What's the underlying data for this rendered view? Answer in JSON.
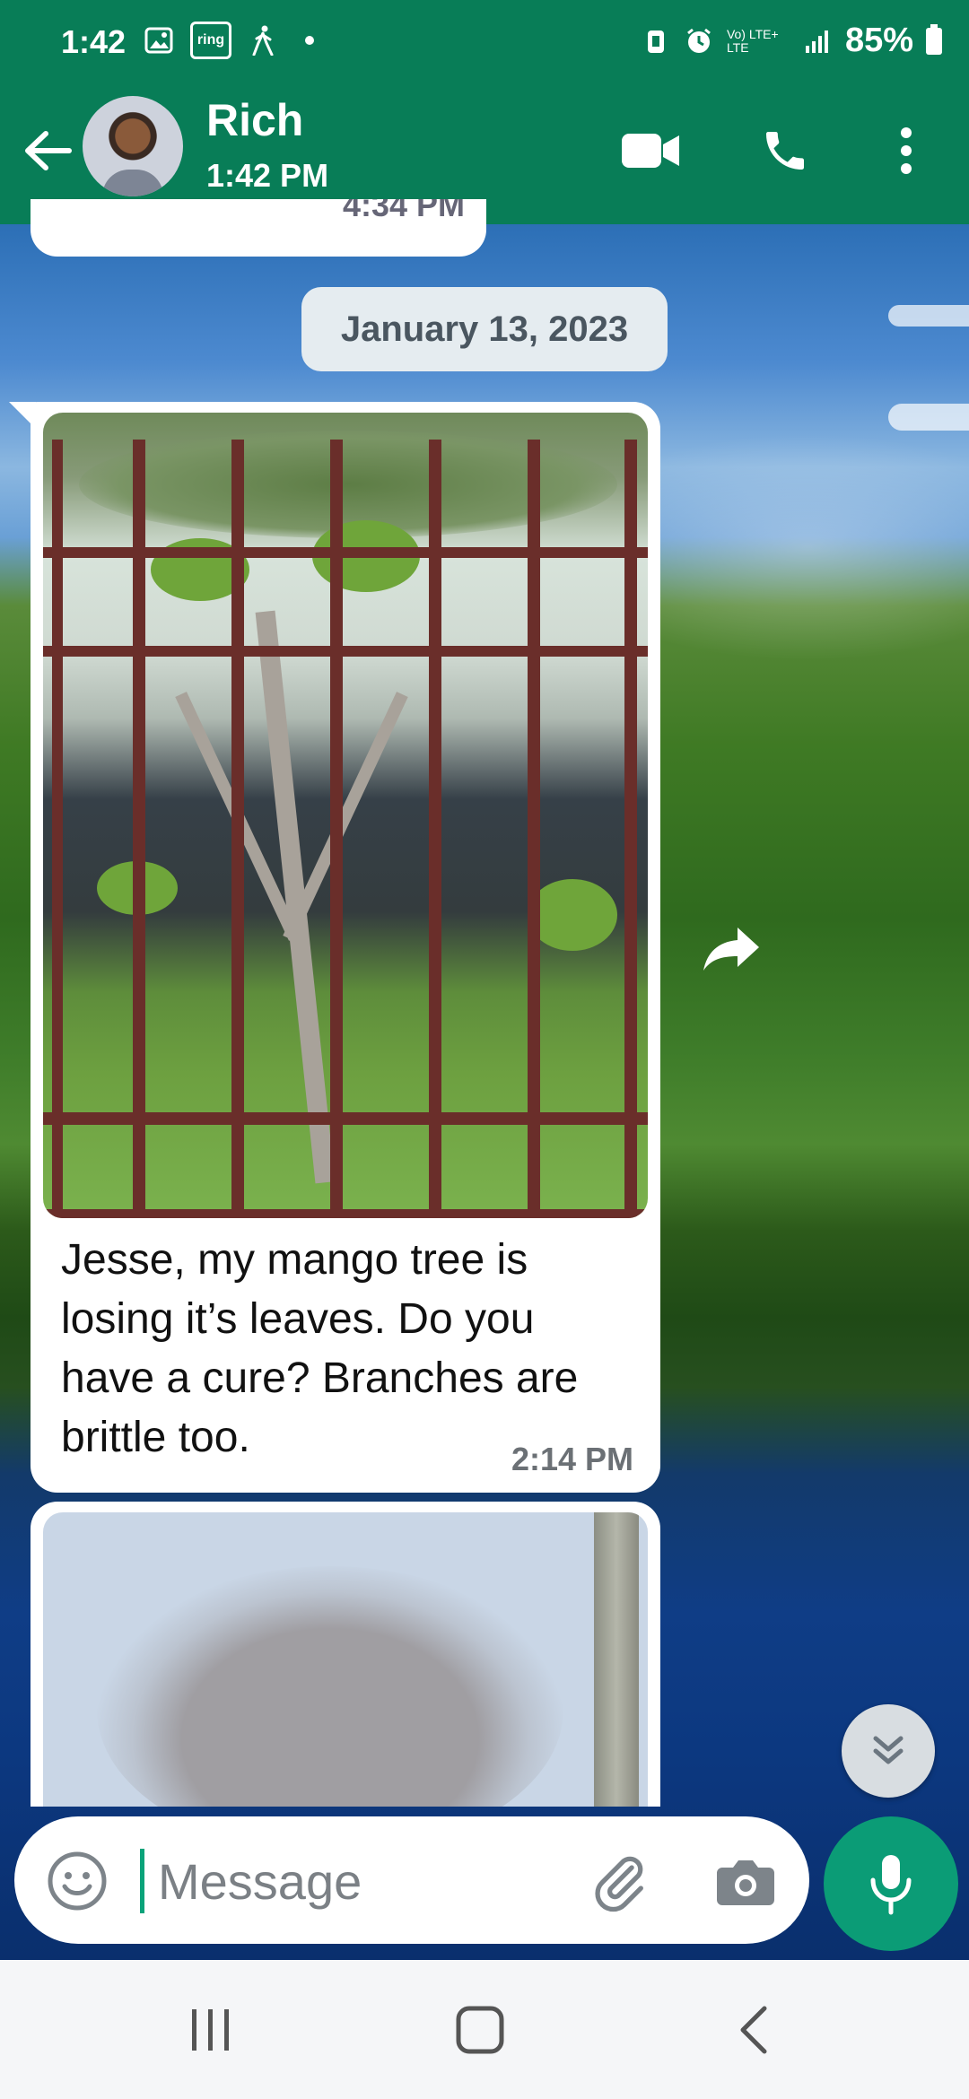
{
  "status_bar": {
    "time": "1:42",
    "ring_label": "ring",
    "network": "Vo) LTE+ LTE",
    "battery": "85%"
  },
  "header": {
    "contact_name": "Rich",
    "subtitle": "1:42 PM"
  },
  "chat": {
    "previous_time": "4:34 PM",
    "date_chip": "January 13, 2023",
    "messages": [
      {
        "text": "Jesse,  my mango tree is losing it’s leaves.  Do you have a cure?  Branches are brittle too.",
        "time": "2:14 PM"
      }
    ]
  },
  "composer": {
    "placeholder": "Message"
  },
  "colors": {
    "header_bg": "#087d57",
    "mic_bg": "#0b9c76"
  },
  "icons": {
    "back": "arrow-left-icon",
    "video": "video-camera-icon",
    "call": "phone-icon",
    "more": "more-vertical-icon",
    "emoji": "emoji-icon",
    "attach": "paperclip-icon",
    "camera": "camera-icon",
    "mic": "microphone-icon",
    "forward": "forward-icon",
    "scroll": "chevrons-down-icon"
  }
}
